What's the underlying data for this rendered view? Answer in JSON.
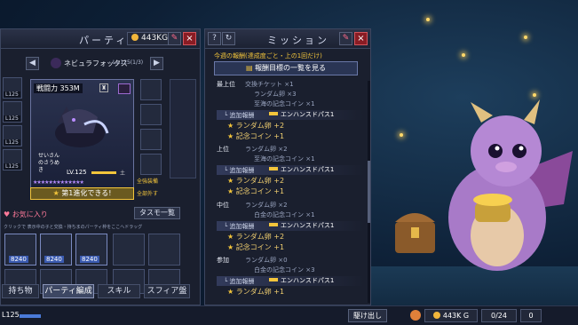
{
  "party": {
    "title": "パーティ",
    "gold": "443KG",
    "character_name": "ネビュラフォックス",
    "character_level": "Lv.125(1/3)",
    "power": "戦闘力 353M",
    "level": "LV.125",
    "element": "土",
    "nickname": "せいさんのさうめき",
    "evolution": "第1進化できる!",
    "equip_label": "全強装備",
    "all_label": "全部外す",
    "favorites": "お気に入り",
    "tasmo_list": "タスモ一覧",
    "hint": "クリックで 表示中の子と交換・持ちまのパーティ枠をここへドラッグ",
    "side_slots": [
      "L125",
      "L125",
      "L125",
      "L125"
    ],
    "members": [
      {
        "power": "8240"
      },
      {
        "power": "8240"
      },
      {
        "power": "8240"
      }
    ],
    "tabs": [
      "持ち物",
      "パーティ編成",
      "スキル",
      "スフィア盤"
    ]
  },
  "mission": {
    "title": "ミッション",
    "weekly": "今週の報酬(達成度ごと・上の1回だけ)",
    "list_button": "報酬目標の一覧を見る",
    "extra": "追加報酬",
    "enhance": "エンハンスドパス1",
    "tiers": [
      {
        "rank": "最上位",
        "items": [
          "交換チケット ×1",
          "ランダム卵 ×3",
          "至海の記念コイン ×1"
        ],
        "bonus": [
          "ランダム卵 +2",
          "記念コイン +1"
        ]
      },
      {
        "rank": "上位",
        "items": [
          "ランダム卵 ×2",
          "至海の記念コイン ×1"
        ],
        "bonus": [
          "ランダム卵 +2",
          "記念コイン +1"
        ]
      },
      {
        "rank": "中位",
        "items": [
          "ランダム卵 ×2",
          "白金の記念コイン ×1"
        ],
        "bonus": [
          "ランダム卵 +2",
          "記念コイン +1"
        ]
      },
      {
        "rank": "参加",
        "items": [
          "ランダム卵 ×0",
          "白金の記念コイン ×3"
        ],
        "bonus": [
          "ランダム卵 +1"
        ]
      }
    ]
  },
  "hud": {
    "level": "L125",
    "run": "駆け出し",
    "gold": "443K G",
    "count": "0/24",
    "zero": "0"
  },
  "colors": {
    "accent": "#f3c53b",
    "close": "#8a1c24",
    "panel": "#1a1f2e"
  }
}
